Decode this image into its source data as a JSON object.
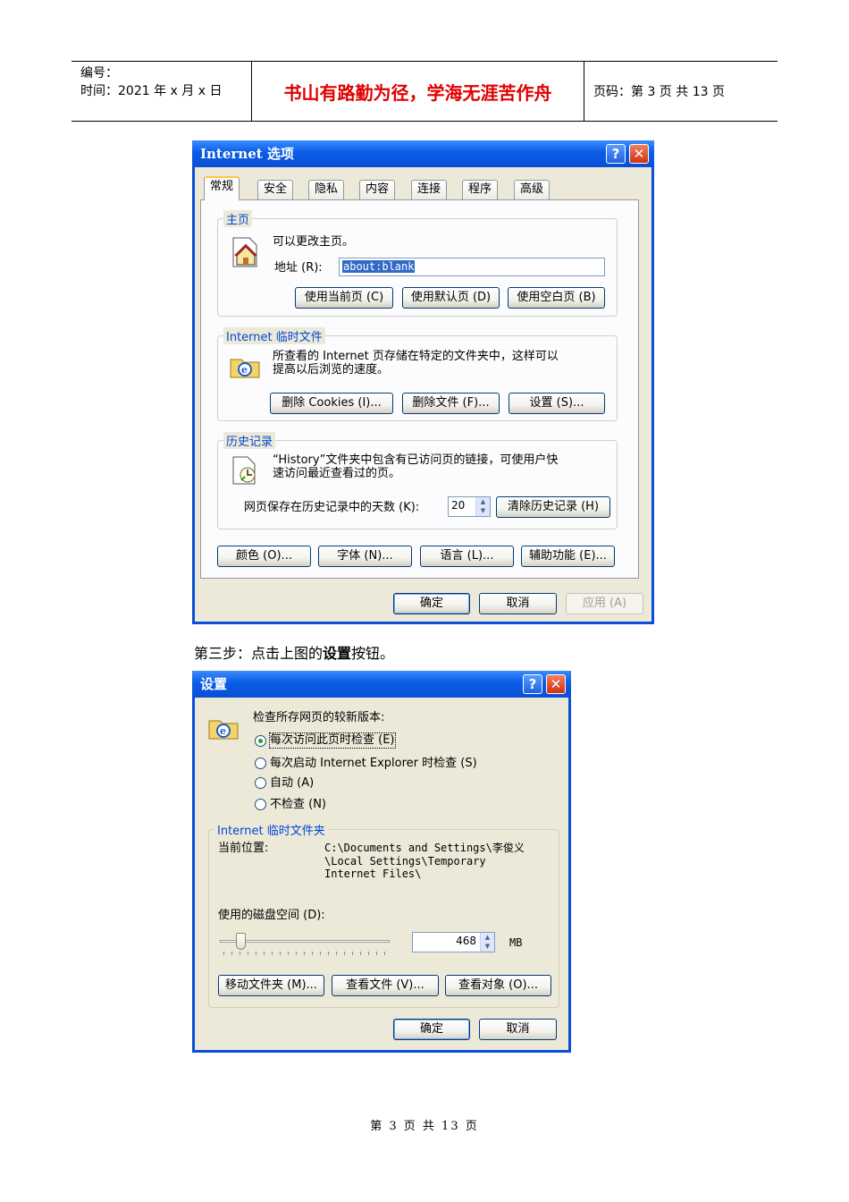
{
  "doc_header": {
    "number_label": "编号：",
    "time_label": "时间：2021 年 x 月 x 日",
    "motto": "书山有路勤为径，学海无涯苦作舟",
    "page_label": "页码：第 3 页  共 13 页"
  },
  "internet_options": {
    "title": "Internet 选项",
    "tabs": [
      "常规",
      "安全",
      "隐私",
      "内容",
      "连接",
      "程序",
      "高级"
    ],
    "homepage": {
      "group_label": "主页",
      "desc": "可以更改主页。",
      "address_label": "地址 (R):",
      "address_value": "about:blank",
      "buttons": [
        "使用当前页 (C)",
        "使用默认页 (D)",
        "使用空白页 (B)"
      ]
    },
    "temp_files": {
      "group_label": "Internet 临时文件",
      "desc_line1": "所查看的 Internet 页存储在特定的文件夹中，这样可以",
      "desc_line2": "提高以后浏览的速度。",
      "buttons": [
        "删除 Cookies (I)...",
        "删除文件 (F)...",
        "设置 (S)..."
      ]
    },
    "history": {
      "group_label": "历史记录",
      "desc_line1": "“History”文件夹中包含有已访问页的链接，可使用户快",
      "desc_line2": "速访问最近查看过的页。",
      "days_label": "网页保存在历史记录中的天数 (K):",
      "days_value": "20",
      "clear_button": "清除历史记录 (H)"
    },
    "bottom_buttons": [
      "颜色 (O)...",
      "字体 (N)...",
      "语言 (L)...",
      "辅助功能 (E)..."
    ],
    "ok": "确定",
    "cancel": "取消",
    "apply": "应用 (A)"
  },
  "step_caption_prefix": "第三步：点击上图的",
  "step_caption_bold": "设置",
  "step_caption_suffix": "按钮。",
  "settings": {
    "title": "设置",
    "check_label": "检查所存网页的较新版本:",
    "options": [
      "每次访问此页时检查 (E)",
      "每次启动 Internet Explorer 时检查 (S)",
      "自动 (A)",
      "不检查 (N)"
    ],
    "selected_option": 0,
    "folder_group_label": "Internet 临时文件夹",
    "location_label": "当前位置:",
    "location_lines": [
      "C:\\Documents and Settings\\李俊义",
      "\\Local Settings\\Temporary",
      "Internet Files\\"
    ],
    "disk_label": "使用的磁盘空间 (D):",
    "disk_value": "468",
    "disk_unit": "MB",
    "disk_slider_fraction": 0.1,
    "buttons": [
      "移动文件夹 (M)...",
      "查看文件 (V)...",
      "查看对象 (O)..."
    ],
    "ok": "确定",
    "cancel": "取消"
  },
  "footer": "第 3 页 共 13 页",
  "colors": {
    "xp_blue": "#0a4fd6",
    "dialog_bg": "#ece9d8",
    "group_label": "#0046d5",
    "motto_red": "#e00000"
  },
  "icons": [
    "help-icon",
    "close-icon",
    "home-page-icon",
    "ie-folder-icon",
    "history-clock-icon",
    "spin-up-icon",
    "spin-down-icon"
  ]
}
